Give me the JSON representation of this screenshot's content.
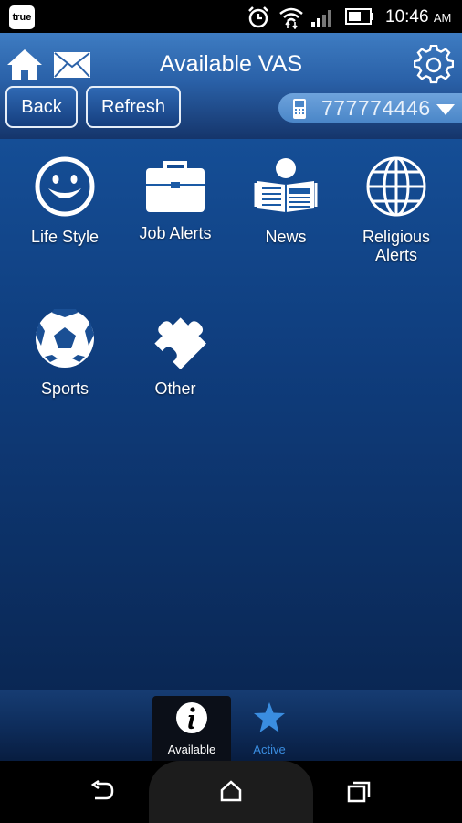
{
  "status_bar": {
    "carrier": "true",
    "time": "10:46",
    "ampm": "AM"
  },
  "header": {
    "title": "Available VAS",
    "back_label": "Back",
    "refresh_label": "Refresh",
    "phone_number": "777774446"
  },
  "services": [
    {
      "label": "Life Style",
      "icon": "smiley-icon"
    },
    {
      "label": "Job Alerts",
      "icon": "briefcase-icon"
    },
    {
      "label": "News",
      "icon": "newspaper-reader-icon"
    },
    {
      "label": "Religious Alerts",
      "icon": "globe-icon"
    },
    {
      "label": "Sports",
      "icon": "soccer-ball-icon"
    },
    {
      "label": "Other",
      "icon": "puzzle-piece-icon"
    }
  ],
  "tabs": [
    {
      "label": "Available",
      "icon": "info-icon",
      "selected": true
    },
    {
      "label": "Active",
      "icon": "star-icon",
      "selected": false
    }
  ],
  "colors": {
    "header_blue": "#2a61a8",
    "background_blue": "#0f3d7d",
    "active_tab_blue": "#3a8de0",
    "number_pill": "#5a93d2"
  }
}
